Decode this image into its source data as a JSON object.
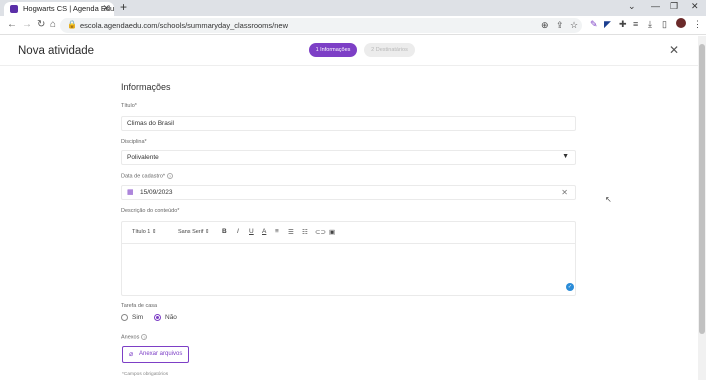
{
  "browser": {
    "tab_title": "Hogwarts CS | Agenda Edu",
    "url": "escola.agendaedu.com/schools/summaryday_classrooms/new",
    "brand_color": "#5b2fa8"
  },
  "header": {
    "title": "Nova atividade",
    "steps": [
      {
        "label": "1 Informações",
        "active": true
      },
      {
        "label": "2 Destinatários",
        "active": false
      }
    ]
  },
  "form": {
    "section_title": "Informações",
    "title_label": "Título*",
    "title_value": "Climas do Brasil",
    "discipline_label": "Disciplina*",
    "discipline_value": "Polivalente",
    "date_label": "Data de cadastro*",
    "date_value": "15/09/2023",
    "description_label": "Descrição do conteúdo*",
    "editor": {
      "heading_select": "Título 1",
      "font_select": "Sans Serif"
    },
    "homework_label": "Tarefa de casa",
    "homework_options": [
      "Sim",
      "Não"
    ],
    "homework_selected": "Não",
    "attachments_label": "Anexos",
    "attach_button": "Anexar arquivos",
    "required_note": "*Campos obrigatórios"
  },
  "accent_color": "#7d3fc6"
}
